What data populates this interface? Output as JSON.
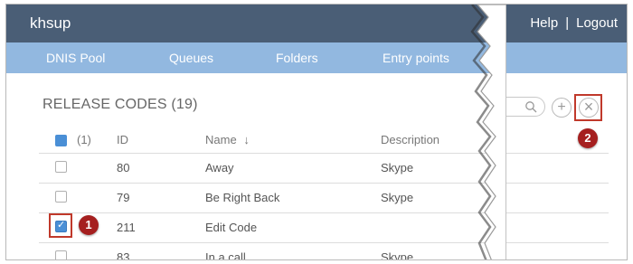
{
  "header": {
    "title": "khsup",
    "help_label": "Help",
    "separator": "|",
    "logout_label": "Logout"
  },
  "nav": {
    "items": [
      "DNIS Pool",
      "Queues",
      "Folders",
      "Entry points"
    ]
  },
  "section": {
    "title": "RELEASE CODES (19)"
  },
  "table": {
    "selected_count": "(1)",
    "columns": {
      "id": "ID",
      "name": "Name",
      "sort_arrow": "↓",
      "description": "Description"
    },
    "rows": [
      {
        "checked": false,
        "id": "80",
        "name": "Away",
        "description": "Skype"
      },
      {
        "checked": false,
        "id": "79",
        "name": "Be Right Back",
        "description": "Skype"
      },
      {
        "checked": true,
        "id": "211",
        "name": "Edit Code",
        "description": ""
      },
      {
        "checked": false,
        "id": "83",
        "name": "In a call",
        "description": "Skype"
      }
    ]
  },
  "actions": {
    "add_label": "+",
    "close_label": "×"
  },
  "callouts": {
    "badge_1": "1",
    "badge_2": "2"
  },
  "colors": {
    "header_bg": "#4a5e76",
    "nav_bg": "#92b8e0",
    "accent": "#4a8fd6",
    "callout": "#a51f1f"
  }
}
